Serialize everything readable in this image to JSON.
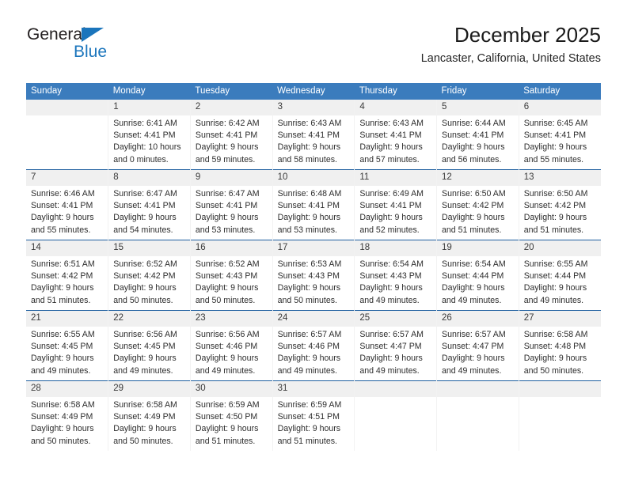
{
  "brand": {
    "name_part1": "General",
    "name_part2": "Blue",
    "triangle_icon": "triangle-icon",
    "accent_color": "#1b75bc"
  },
  "header": {
    "title": "December 2025",
    "subtitle": "Lancaster, California, United States"
  },
  "colors": {
    "header_blue": "#3b7cbd",
    "row_divider_blue": "#1f5fa0",
    "daynum_band": "#f0f0f0"
  },
  "calendar": {
    "weekday_headers": [
      "Sunday",
      "Monday",
      "Tuesday",
      "Wednesday",
      "Thursday",
      "Friday",
      "Saturday"
    ],
    "weeks": [
      [
        {
          "day": "",
          "sunrise": "",
          "sunset": "",
          "daylight_line1": "",
          "daylight_line2": ""
        },
        {
          "day": "1",
          "sunrise": "Sunrise: 6:41 AM",
          "sunset": "Sunset: 4:41 PM",
          "daylight_line1": "Daylight: 10 hours",
          "daylight_line2": "and 0 minutes."
        },
        {
          "day": "2",
          "sunrise": "Sunrise: 6:42 AM",
          "sunset": "Sunset: 4:41 PM",
          "daylight_line1": "Daylight: 9 hours",
          "daylight_line2": "and 59 minutes."
        },
        {
          "day": "3",
          "sunrise": "Sunrise: 6:43 AM",
          "sunset": "Sunset: 4:41 PM",
          "daylight_line1": "Daylight: 9 hours",
          "daylight_line2": "and 58 minutes."
        },
        {
          "day": "4",
          "sunrise": "Sunrise: 6:43 AM",
          "sunset": "Sunset: 4:41 PM",
          "daylight_line1": "Daylight: 9 hours",
          "daylight_line2": "and 57 minutes."
        },
        {
          "day": "5",
          "sunrise": "Sunrise: 6:44 AM",
          "sunset": "Sunset: 4:41 PM",
          "daylight_line1": "Daylight: 9 hours",
          "daylight_line2": "and 56 minutes."
        },
        {
          "day": "6",
          "sunrise": "Sunrise: 6:45 AM",
          "sunset": "Sunset: 4:41 PM",
          "daylight_line1": "Daylight: 9 hours",
          "daylight_line2": "and 55 minutes."
        }
      ],
      [
        {
          "day": "7",
          "sunrise": "Sunrise: 6:46 AM",
          "sunset": "Sunset: 4:41 PM",
          "daylight_line1": "Daylight: 9 hours",
          "daylight_line2": "and 55 minutes."
        },
        {
          "day": "8",
          "sunrise": "Sunrise: 6:47 AM",
          "sunset": "Sunset: 4:41 PM",
          "daylight_line1": "Daylight: 9 hours",
          "daylight_line2": "and 54 minutes."
        },
        {
          "day": "9",
          "sunrise": "Sunrise: 6:47 AM",
          "sunset": "Sunset: 4:41 PM",
          "daylight_line1": "Daylight: 9 hours",
          "daylight_line2": "and 53 minutes."
        },
        {
          "day": "10",
          "sunrise": "Sunrise: 6:48 AM",
          "sunset": "Sunset: 4:41 PM",
          "daylight_line1": "Daylight: 9 hours",
          "daylight_line2": "and 53 minutes."
        },
        {
          "day": "11",
          "sunrise": "Sunrise: 6:49 AM",
          "sunset": "Sunset: 4:41 PM",
          "daylight_line1": "Daylight: 9 hours",
          "daylight_line2": "and 52 minutes."
        },
        {
          "day": "12",
          "sunrise": "Sunrise: 6:50 AM",
          "sunset": "Sunset: 4:42 PM",
          "daylight_line1": "Daylight: 9 hours",
          "daylight_line2": "and 51 minutes."
        },
        {
          "day": "13",
          "sunrise": "Sunrise: 6:50 AM",
          "sunset": "Sunset: 4:42 PM",
          "daylight_line1": "Daylight: 9 hours",
          "daylight_line2": "and 51 minutes."
        }
      ],
      [
        {
          "day": "14",
          "sunrise": "Sunrise: 6:51 AM",
          "sunset": "Sunset: 4:42 PM",
          "daylight_line1": "Daylight: 9 hours",
          "daylight_line2": "and 51 minutes."
        },
        {
          "day": "15",
          "sunrise": "Sunrise: 6:52 AM",
          "sunset": "Sunset: 4:42 PM",
          "daylight_line1": "Daylight: 9 hours",
          "daylight_line2": "and 50 minutes."
        },
        {
          "day": "16",
          "sunrise": "Sunrise: 6:52 AM",
          "sunset": "Sunset: 4:43 PM",
          "daylight_line1": "Daylight: 9 hours",
          "daylight_line2": "and 50 minutes."
        },
        {
          "day": "17",
          "sunrise": "Sunrise: 6:53 AM",
          "sunset": "Sunset: 4:43 PM",
          "daylight_line1": "Daylight: 9 hours",
          "daylight_line2": "and 50 minutes."
        },
        {
          "day": "18",
          "sunrise": "Sunrise: 6:54 AM",
          "sunset": "Sunset: 4:43 PM",
          "daylight_line1": "Daylight: 9 hours",
          "daylight_line2": "and 49 minutes."
        },
        {
          "day": "19",
          "sunrise": "Sunrise: 6:54 AM",
          "sunset": "Sunset: 4:44 PM",
          "daylight_line1": "Daylight: 9 hours",
          "daylight_line2": "and 49 minutes."
        },
        {
          "day": "20",
          "sunrise": "Sunrise: 6:55 AM",
          "sunset": "Sunset: 4:44 PM",
          "daylight_line1": "Daylight: 9 hours",
          "daylight_line2": "and 49 minutes."
        }
      ],
      [
        {
          "day": "21",
          "sunrise": "Sunrise: 6:55 AM",
          "sunset": "Sunset: 4:45 PM",
          "daylight_line1": "Daylight: 9 hours",
          "daylight_line2": "and 49 minutes."
        },
        {
          "day": "22",
          "sunrise": "Sunrise: 6:56 AM",
          "sunset": "Sunset: 4:45 PM",
          "daylight_line1": "Daylight: 9 hours",
          "daylight_line2": "and 49 minutes."
        },
        {
          "day": "23",
          "sunrise": "Sunrise: 6:56 AM",
          "sunset": "Sunset: 4:46 PM",
          "daylight_line1": "Daylight: 9 hours",
          "daylight_line2": "and 49 minutes."
        },
        {
          "day": "24",
          "sunrise": "Sunrise: 6:57 AM",
          "sunset": "Sunset: 4:46 PM",
          "daylight_line1": "Daylight: 9 hours",
          "daylight_line2": "and 49 minutes."
        },
        {
          "day": "25",
          "sunrise": "Sunrise: 6:57 AM",
          "sunset": "Sunset: 4:47 PM",
          "daylight_line1": "Daylight: 9 hours",
          "daylight_line2": "and 49 minutes."
        },
        {
          "day": "26",
          "sunrise": "Sunrise: 6:57 AM",
          "sunset": "Sunset: 4:47 PM",
          "daylight_line1": "Daylight: 9 hours",
          "daylight_line2": "and 49 minutes."
        },
        {
          "day": "27",
          "sunrise": "Sunrise: 6:58 AM",
          "sunset": "Sunset: 4:48 PM",
          "daylight_line1": "Daylight: 9 hours",
          "daylight_line2": "and 50 minutes."
        }
      ],
      [
        {
          "day": "28",
          "sunrise": "Sunrise: 6:58 AM",
          "sunset": "Sunset: 4:49 PM",
          "daylight_line1": "Daylight: 9 hours",
          "daylight_line2": "and 50 minutes."
        },
        {
          "day": "29",
          "sunrise": "Sunrise: 6:58 AM",
          "sunset": "Sunset: 4:49 PM",
          "daylight_line1": "Daylight: 9 hours",
          "daylight_line2": "and 50 minutes."
        },
        {
          "day": "30",
          "sunrise": "Sunrise: 6:59 AM",
          "sunset": "Sunset: 4:50 PM",
          "daylight_line1": "Daylight: 9 hours",
          "daylight_line2": "and 51 minutes."
        },
        {
          "day": "31",
          "sunrise": "Sunrise: 6:59 AM",
          "sunset": "Sunset: 4:51 PM",
          "daylight_line1": "Daylight: 9 hours",
          "daylight_line2": "and 51 minutes."
        },
        {
          "day": "",
          "sunrise": "",
          "sunset": "",
          "daylight_line1": "",
          "daylight_line2": ""
        },
        {
          "day": "",
          "sunrise": "",
          "sunset": "",
          "daylight_line1": "",
          "daylight_line2": ""
        },
        {
          "day": "",
          "sunrise": "",
          "sunset": "",
          "daylight_line1": "",
          "daylight_line2": ""
        }
      ]
    ]
  }
}
